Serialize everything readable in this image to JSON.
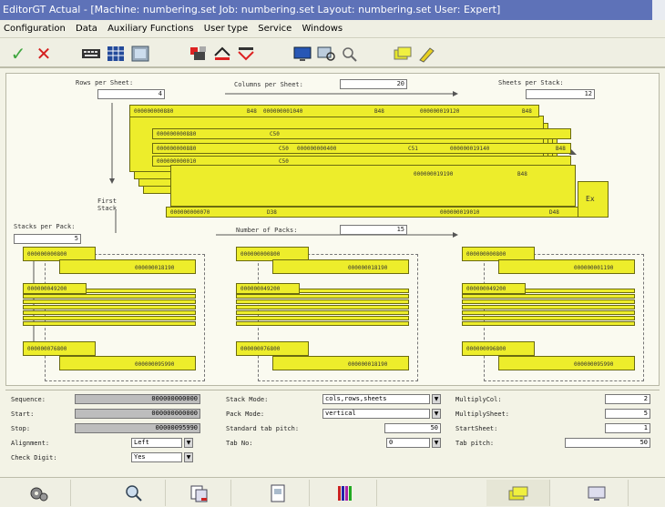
{
  "title": "EditorGT Actual - [Machine: numbering.set   Job: numbering.set   Layout: numbering.set   User: Expert]",
  "menu": [
    "Configuration",
    "Data",
    "Auxiliary Functions",
    "User type",
    "Service",
    "Windows"
  ],
  "toolbar_icons": [
    "check-icon",
    "close-icon",
    "keyboard-icon",
    "grid-icon",
    "image-icon",
    "tools-icon",
    "transfer-icon",
    "transfer-red-icon",
    "monitor-icon",
    "monitor-search-icon",
    "search-icon",
    "stack-icon",
    "pencil-icon"
  ],
  "layout": {
    "rows_per_sheet_label": "Rows per Sheet:",
    "rows_per_sheet": "4",
    "columns_per_sheet_label": "Columns per Sheet:",
    "columns_per_sheet": "20",
    "sheets_per_stack_label": "Sheets per Stack:",
    "sheets_per_stack": "12",
    "first_stack_label": "First\nStack",
    "stacks_per_pack_label": "Stacks per Pack:",
    "stacks_per_pack": "5",
    "number_of_packs_label": "Number of Packs:",
    "number_of_packs": "15",
    "sheet_cells": {
      "r1c1": "000000000880",
      "r1c1b": "B48",
      "r1c2": "000000001040",
      "r1c2b": "B48",
      "r1c3": "000000019120",
      "r1c3b": "B48",
      "s2": "000000000880",
      "s2b": "C50",
      "s3a": "000000000880",
      "s3ab": "C50",
      "s3b": "000000000400",
      "s3bb": "C51",
      "s3c": "000000019140",
      "s3cb": "B48",
      "s4a": "000000000010",
      "s4ab": "C50",
      "s5": "000000019190",
      "s5b": "B48",
      "bot1": "000000000070",
      "bot1b": "D38",
      "bot2": "000000019010",
      "bot2b": "D48",
      "side": "Ex"
    },
    "packs": [
      {
        "top": "000000000800",
        "top_right": "000000018190",
        "mid": "000000049200",
        "bot_left": "000000076800",
        "bot_right": "000000095990"
      },
      {
        "top": "000000000800",
        "top_right": "000000018190",
        "mid": "000000049200",
        "bot_left": "000000076800",
        "bot_right": "000000018190"
      },
      {
        "top": "000000000800",
        "top_right": "000000001190",
        "mid": "000000049200",
        "bot_left": "000000096800",
        "bot_right": "000000095990"
      }
    ]
  },
  "params": {
    "sequence_label": "Sequence:",
    "sequence": "000000000000",
    "start_label": "Start:",
    "start": "000000000000",
    "stop_label": "Stop:",
    "stop": "00000095990",
    "alignment_label": "Alignment:",
    "alignment": "Left",
    "check_digit_label": "Check Digit:",
    "check_digit": "Yes",
    "stack_mode_label": "Stack Mode:",
    "stack_mode": "cols,rows,sheets",
    "pack_mode_label": "Pack Mode:",
    "pack_mode": "vertical",
    "standard_tab_pitch_label": "Standard tab pitch:",
    "standard_tab_pitch": "50",
    "tab_no_label": "Tab No:",
    "tab_no": "0",
    "multiply_col_label": "MultiplyCol:",
    "multiply_col": "2",
    "multiply_sheet_label": "MultiplySheet:",
    "multiply_sheet": "5",
    "start_sheet_label": "StartSheet:",
    "start_sheet": "1",
    "tab_pitch_label": "Tab pitch:",
    "tab_pitch": "50"
  },
  "bottom_icons": [
    "gears-icon",
    "search-chart-icon",
    "copy-icon",
    "document-icon",
    "color-bars-icon",
    "stacks-icon",
    "monitor-icon"
  ]
}
